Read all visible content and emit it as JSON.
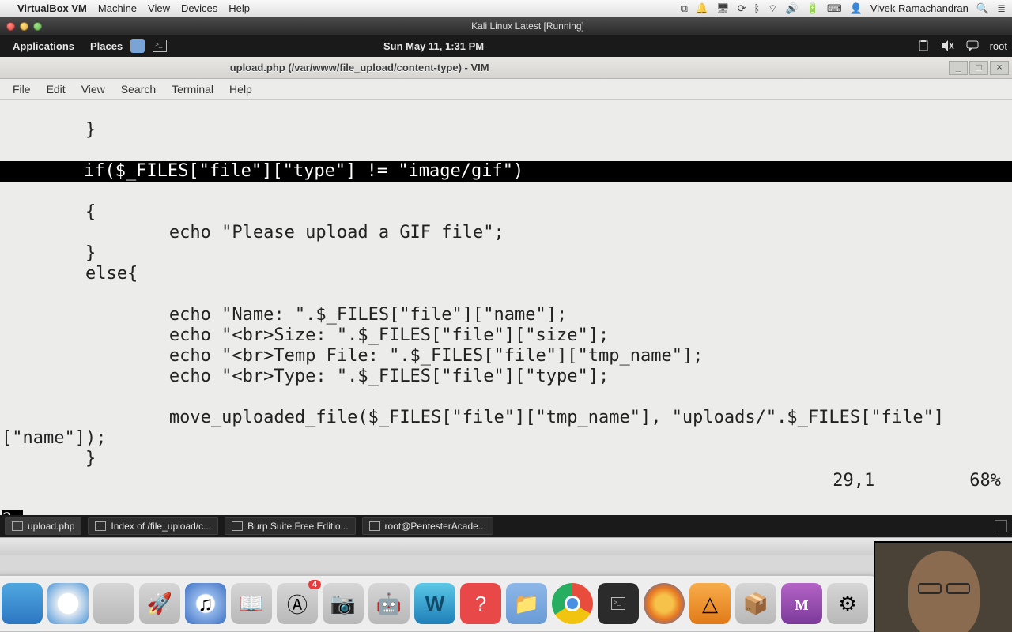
{
  "mac_menu": {
    "app": "VirtualBox VM",
    "items": [
      "Machine",
      "View",
      "Devices",
      "Help"
    ],
    "user": "Vivek Ramachandran"
  },
  "vm_window": {
    "title": "Kali Linux Latest [Running]"
  },
  "gnome_top": {
    "applications": "Applications",
    "places": "Places",
    "clock": "Sun May 11,  1:31 PM",
    "user": "root"
  },
  "window": {
    "title": "upload.php (/var/www/file_upload/content-type) - VIM"
  },
  "term_menu": [
    "File",
    "Edit",
    "View",
    "Search",
    "Terminal",
    "Help"
  ],
  "code": {
    "l0": "        }",
    "l1": "        if($_FILES[\"file\"][\"type\"] != \"image/gif\")",
    "l2": "        {",
    "l3": "                echo \"Please upload a GIF file\";",
    "l4": "        }",
    "l5": "        else{",
    "l6": "                echo \"Name: \".$_FILES[\"file\"][\"name\"];",
    "l7": "                echo \"<br>Size: \".$_FILES[\"file\"][\"size\"];",
    "l8": "                echo \"<br>Temp File: \".$_FILES[\"file\"][\"tmp_name\"];",
    "l9": "                echo \"<br>Type: \".$_FILES[\"file\"][\"type\"];",
    "l10": "                move_uploaded_file($_FILES[\"file\"][\"tmp_name\"], \"uploads/\".$_FILES[\"file\"]",
    "l11": "[\"name\"]);",
    "l12": "        }",
    "endtag": "?>"
  },
  "vim_status": {
    "pos": "29,1",
    "pct": "68%"
  },
  "taskbar": {
    "items": [
      {
        "label": "upload.php"
      },
      {
        "label": "Index of /file_upload/c..."
      },
      {
        "label": "Burp Suite Free Editio..."
      },
      {
        "label": "root@PentesterAcade..."
      }
    ]
  },
  "dock": {
    "appstore_badge": "4",
    "wireshark": "W",
    "mamp": "ᴍ",
    "question": "?"
  }
}
